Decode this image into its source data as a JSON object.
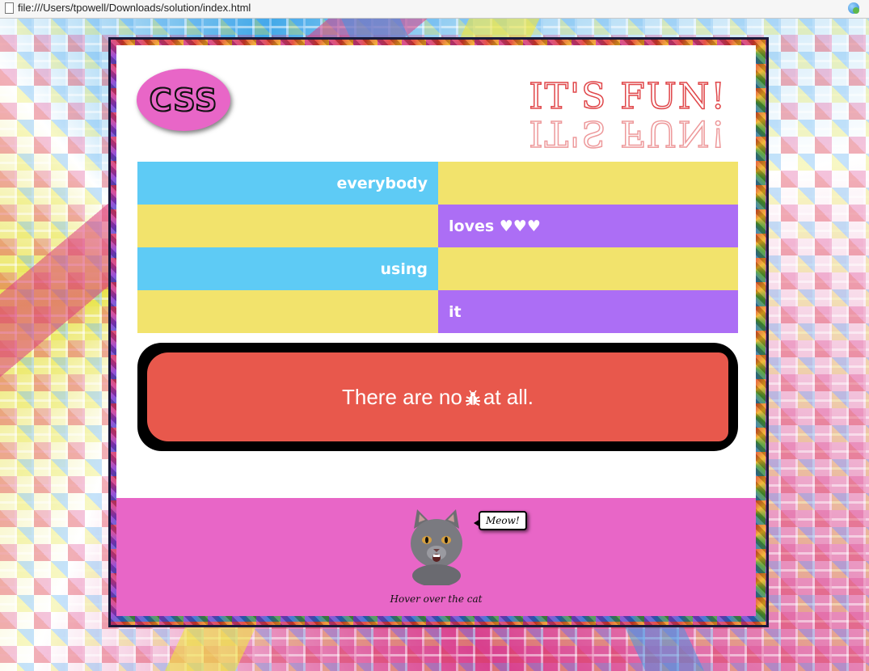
{
  "browser": {
    "url": "file:///Users/tpowell/Downloads/solution/index.html"
  },
  "header": {
    "logo_text": "CSS",
    "fun_text": "IT'S FUN!"
  },
  "grid": {
    "rows": [
      {
        "left": "everybody",
        "right": ""
      },
      {
        "left": "",
        "right": "loves  ♥♥♥"
      },
      {
        "left": "using",
        "right": ""
      },
      {
        "left": "",
        "right": "it"
      }
    ]
  },
  "bugbox": {
    "before": "There are no",
    "after": "at all."
  },
  "footer": {
    "speech": "Meow!",
    "caption": "Hover over the cat"
  },
  "colors": {
    "blue": "#5ecbf5",
    "yellow": "#f2e36c",
    "purple": "#ac6ef5",
    "pink": "#e866c7",
    "red": "#e8584c"
  }
}
